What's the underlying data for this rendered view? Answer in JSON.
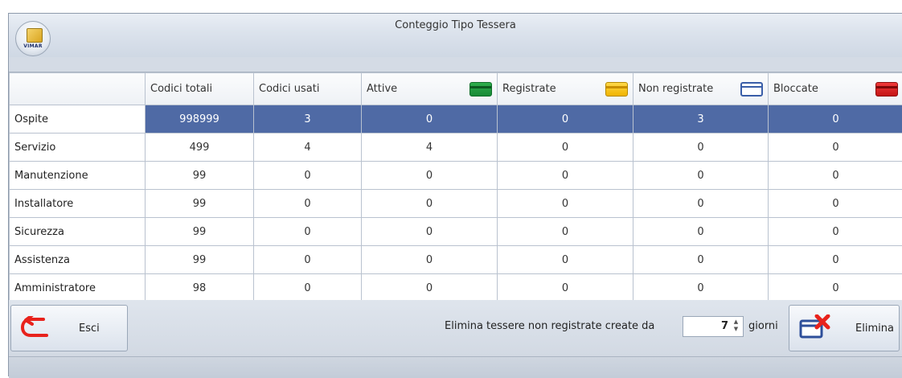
{
  "window": {
    "title": "Conteggio Tipo Tessera",
    "logo_text": "VIMAR"
  },
  "table": {
    "columns": [
      {
        "label": "Codici totali",
        "icon": null
      },
      {
        "label": "Codici usati",
        "icon": null
      },
      {
        "label": "Attive",
        "icon": "card-green-icon"
      },
      {
        "label": "Registrate",
        "icon": "card-yellow-icon"
      },
      {
        "label": "Non registrate",
        "icon": "card-white-icon"
      },
      {
        "label": "Bloccate",
        "icon": "card-red-icon"
      }
    ],
    "rows": [
      {
        "name": "Ospite",
        "values": [
          "998999",
          "3",
          "0",
          "0",
          "3",
          "0"
        ],
        "selected": true
      },
      {
        "name": "Servizio",
        "values": [
          "499",
          "4",
          "4",
          "0",
          "0",
          "0"
        ],
        "selected": false
      },
      {
        "name": "Manutenzione",
        "values": [
          "99",
          "0",
          "0",
          "0",
          "0",
          "0"
        ],
        "selected": false
      },
      {
        "name": "Installatore",
        "values": [
          "99",
          "0",
          "0",
          "0",
          "0",
          "0"
        ],
        "selected": false
      },
      {
        "name": "Sicurezza",
        "values": [
          "99",
          "0",
          "0",
          "0",
          "0",
          "0"
        ],
        "selected": false
      },
      {
        "name": "Assistenza",
        "values": [
          "99",
          "0",
          "0",
          "0",
          "0",
          "0"
        ],
        "selected": false
      },
      {
        "name": "Amministratore",
        "values": [
          "98",
          "0",
          "0",
          "0",
          "0",
          "0"
        ],
        "selected": false
      }
    ]
  },
  "footer": {
    "exit_label": "Esci",
    "delete_text": "Elimina tessere non registrate create da",
    "days_value": "7",
    "days_unit": "giorni",
    "delete_label": "Elimina"
  },
  "colors": {
    "selection": "#4f6aa5",
    "exit_icon": "#e8221c",
    "delete_icon": "#e8221c"
  }
}
